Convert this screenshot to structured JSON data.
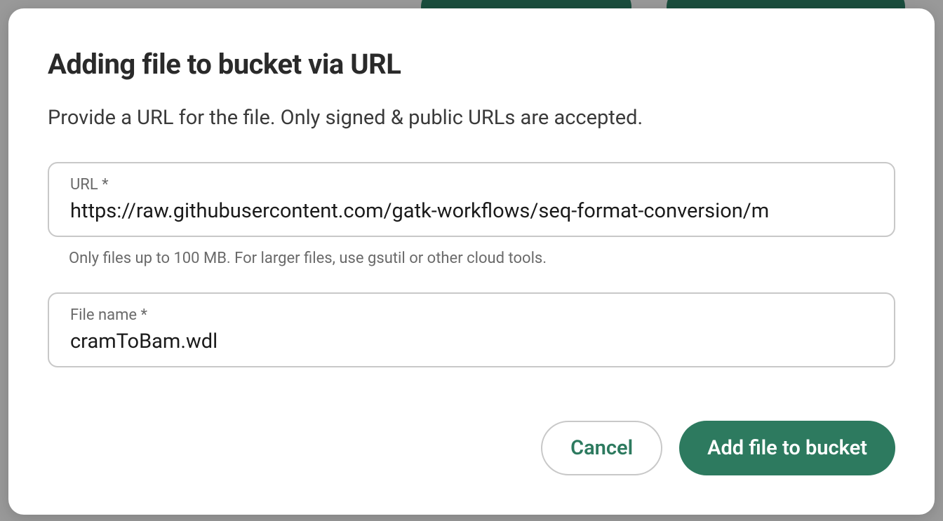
{
  "modal": {
    "title": "Adding file to bucket via URL",
    "description": "Provide a URL for the file. Only signed & public URLs are accepted.",
    "fields": {
      "url": {
        "label": "URL *",
        "value": "https://raw.githubusercontent.com/gatk-workflows/seq-format-conversion/m",
        "hint": "Only files up to 100 MB. For larger files, use gsutil or other cloud tools."
      },
      "filename": {
        "label": "File name *",
        "value": "cramToBam.wdl"
      }
    },
    "buttons": {
      "cancel": "Cancel",
      "submit": "Add file to bucket"
    }
  }
}
